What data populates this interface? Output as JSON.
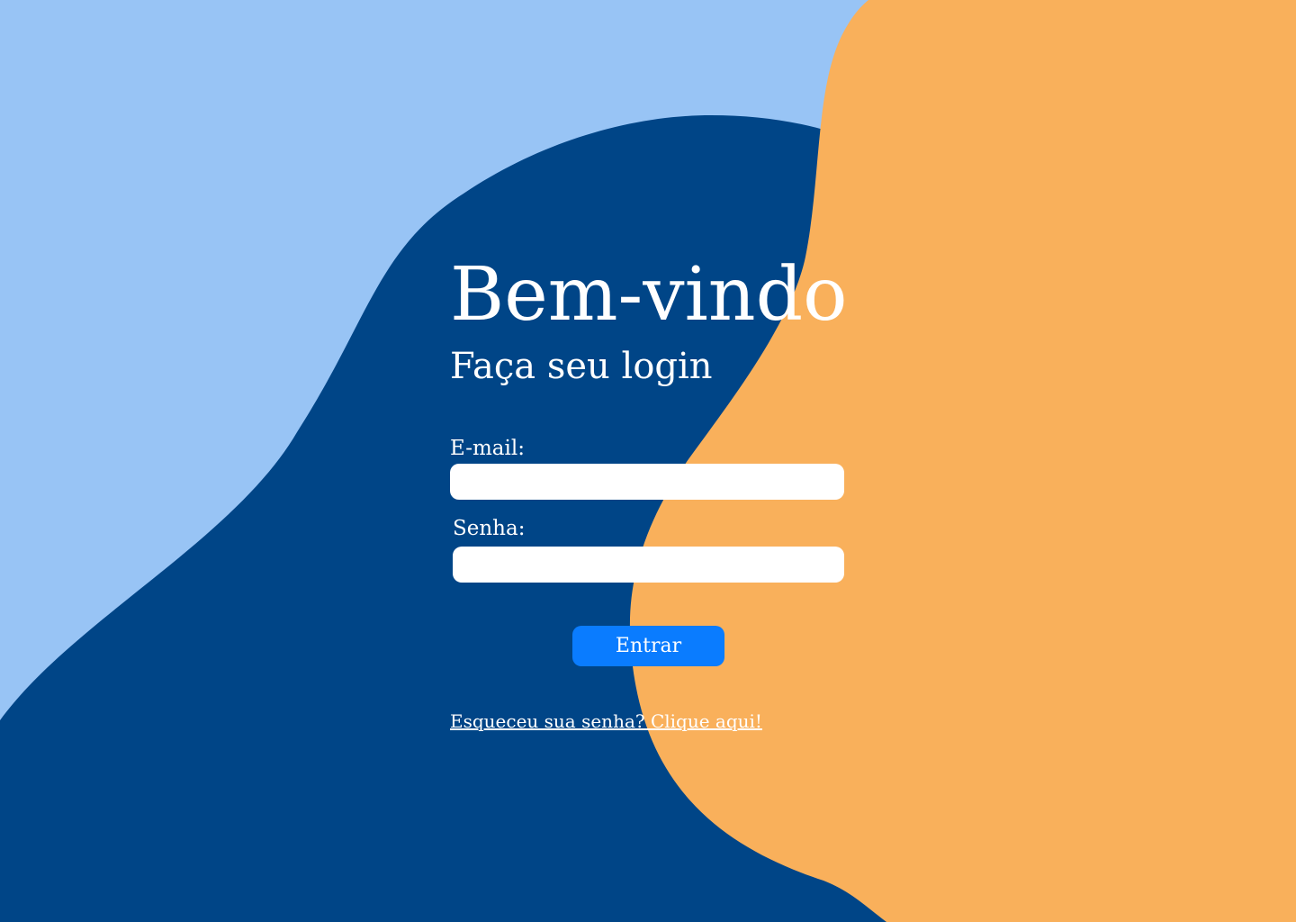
{
  "colors": {
    "background_light_blue": "#98c4f5",
    "blob_dark_blue": "#004587",
    "blob_orange": "#f9b05b",
    "button_blue": "#0a7cff",
    "text_white": "#ffffff"
  },
  "login": {
    "title": "Bem-vindo",
    "subtitle": "Faça seu login",
    "email_label": "E-mail:",
    "email_value": "",
    "password_label": "Senha:",
    "password_value": "",
    "submit_label": "Entrar",
    "forgot_link": "Esqueceu sua senha? Clique aqui!"
  }
}
